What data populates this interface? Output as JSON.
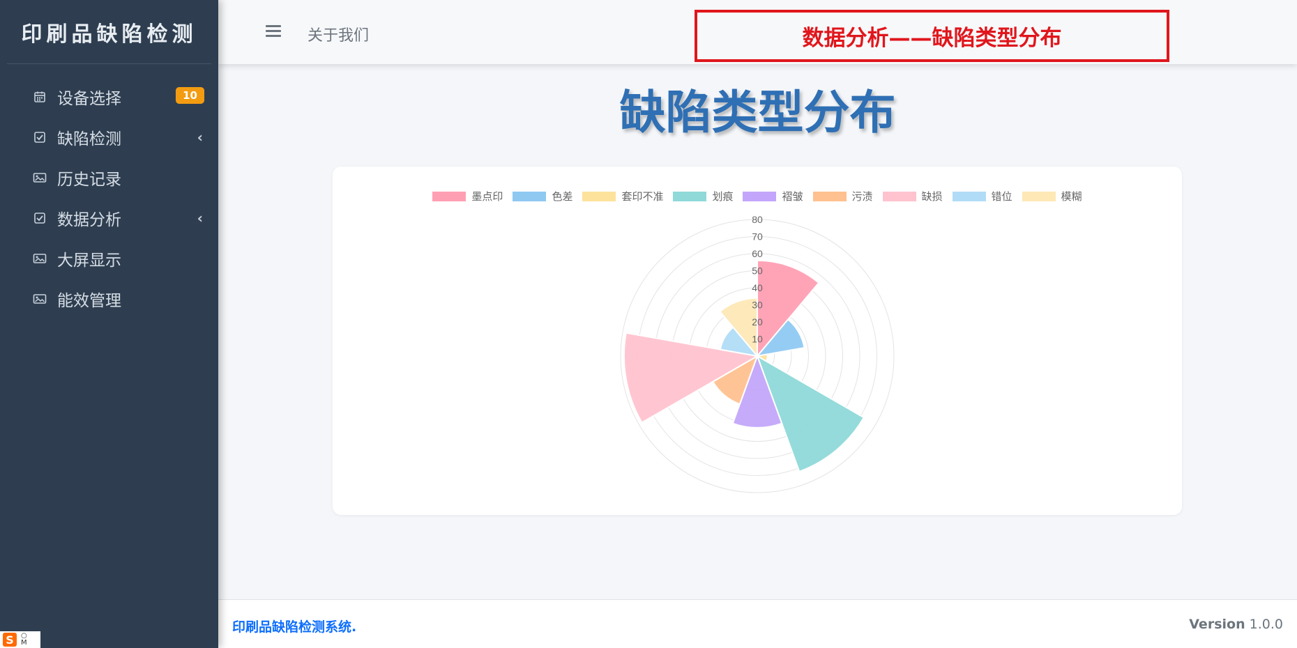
{
  "app": {
    "brand": "印刷品缺陷检测"
  },
  "sidebar": {
    "items": [
      {
        "label": "设备选择",
        "icon": "calendar-icon",
        "badge": "10"
      },
      {
        "label": "缺陷检测",
        "icon": "checkbox-icon",
        "chevron": "‹"
      },
      {
        "label": "历史记录",
        "icon": "image-icon"
      },
      {
        "label": "数据分析",
        "icon": "checkbox-icon",
        "chevron": "‹"
      },
      {
        "label": "大屏显示",
        "icon": "image-icon"
      },
      {
        "label": "能效管理",
        "icon": "image-icon"
      }
    ]
  },
  "header": {
    "about": "关于我们",
    "banner": "数据分析——缺陷类型分布"
  },
  "main": {
    "title": "缺陷类型分布"
  },
  "chart_data": {
    "type": "polarArea",
    "categories": [
      "墨点印",
      "色差",
      "套印不准",
      "划痕",
      "褶皱",
      "污渍",
      "缺损",
      "错位",
      "模糊"
    ],
    "values": [
      56,
      28,
      6,
      72,
      42,
      30,
      78,
      22,
      34
    ],
    "colors": [
      "#ff9fb3",
      "#8fc9f2",
      "#fde29c",
      "#8fd9d9",
      "#c3a6fb",
      "#ffc18f",
      "#ffc3cf",
      "#b1dcf7",
      "#fde8b6"
    ],
    "rlim": [
      0,
      80
    ],
    "r_ticks": [
      "10",
      "20",
      "30",
      "40",
      "50",
      "60",
      "70",
      "80"
    ],
    "legend": "top",
    "grid": true
  },
  "footer": {
    "copyright": "印刷品缺陷检测系统.",
    "version_label": "Version",
    "version": "1.0.0"
  },
  "ime": {
    "logo": "S"
  }
}
